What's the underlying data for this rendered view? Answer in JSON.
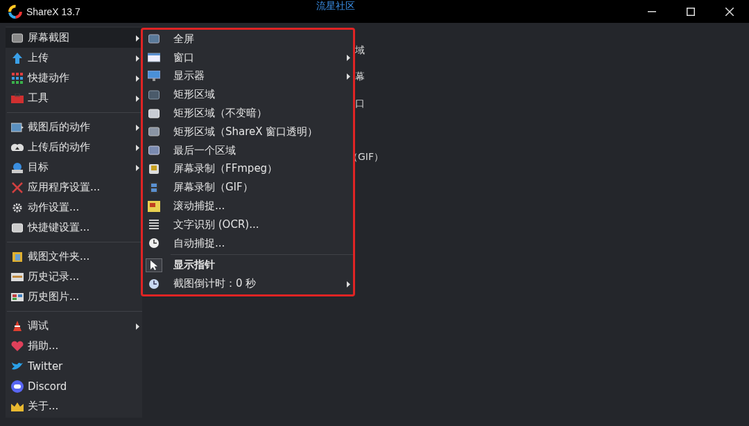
{
  "window": {
    "title": "ShareX 13.7",
    "watermark_text": "流星社区"
  },
  "background_fragments": [
    "域",
    "幕",
    "口",
    "（GIF）"
  ],
  "main_menu": {
    "groups": [
      [
        {
          "label": "屏幕截图",
          "submenu": true,
          "selected": true
        },
        {
          "label": "上传",
          "submenu": true,
          "selected": false
        },
        {
          "label": "快捷动作",
          "submenu": true,
          "selected": false
        },
        {
          "label": "工具",
          "submenu": true,
          "selected": false
        }
      ],
      [
        {
          "label": "截图后的动作",
          "submenu": true,
          "selected": false
        },
        {
          "label": "上传后的动作",
          "submenu": true,
          "selected": false
        },
        {
          "label": "目标",
          "submenu": true,
          "selected": false
        },
        {
          "label": "应用程序设置...",
          "submenu": false,
          "selected": false
        },
        {
          "label": "动作设置...",
          "submenu": false,
          "selected": false
        },
        {
          "label": "快捷键设置...",
          "submenu": false,
          "selected": false
        }
      ],
      [
        {
          "label": "截图文件夹...",
          "submenu": false,
          "selected": false
        },
        {
          "label": "历史记录...",
          "submenu": false,
          "selected": false
        },
        {
          "label": "历史图片...",
          "submenu": false,
          "selected": false
        }
      ],
      [
        {
          "label": "调试",
          "submenu": true,
          "selected": false
        },
        {
          "label": "捐助...",
          "submenu": false,
          "selected": false
        },
        {
          "label": "Twitter",
          "submenu": false,
          "selected": false
        },
        {
          "label": "Discord",
          "submenu": false,
          "selected": false
        },
        {
          "label": "关于...",
          "submenu": false,
          "selected": false
        }
      ]
    ]
  },
  "submenu": {
    "highlighted": true,
    "groups": [
      [
        {
          "label": "全屏",
          "submenu": false,
          "checked": false
        },
        {
          "label": "窗口",
          "submenu": true,
          "checked": false
        },
        {
          "label": "显示器",
          "submenu": true,
          "checked": false
        },
        {
          "label": "矩形区域",
          "submenu": false,
          "checked": false
        },
        {
          "label": "矩形区域（不变暗）",
          "submenu": false,
          "checked": false
        },
        {
          "label": "矩形区域（ShareX 窗口透明）",
          "submenu": false,
          "checked": false
        },
        {
          "label": "最后一个区域",
          "submenu": false,
          "checked": false
        },
        {
          "label": "屏幕录制（FFmpeg）",
          "submenu": false,
          "checked": false
        },
        {
          "label": "屏幕录制（GIF）",
          "submenu": false,
          "checked": false
        },
        {
          "label": "滚动捕捉...",
          "submenu": false,
          "checked": false
        },
        {
          "label": "文字识别 (OCR)...",
          "submenu": false,
          "checked": false
        },
        {
          "label": "自动捕捉...",
          "submenu": false,
          "checked": false
        }
      ],
      [
        {
          "label": "显示指针",
          "submenu": false,
          "checked": true
        },
        {
          "label": "截图倒计时：0 秒",
          "submenu": true,
          "checked": false
        }
      ]
    ]
  }
}
